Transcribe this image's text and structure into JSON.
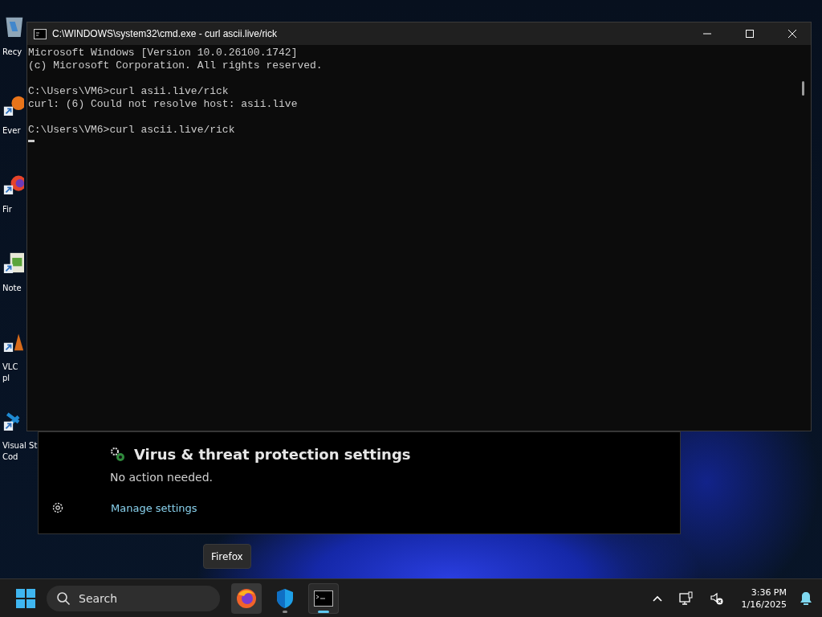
{
  "desktop_icons": [
    {
      "kind": "bin",
      "lines": [
        "Recy"
      ],
      "shortcut": false
    },
    {
      "kind": "app",
      "lines": [
        "Ever"
      ],
      "shortcut": true
    },
    {
      "kind": "firefox",
      "lines": [
        "Fir"
      ],
      "shortcut": true
    },
    {
      "kind": "notepad",
      "lines": [
        "Note"
      ],
      "shortcut": true
    },
    {
      "kind": "vlc",
      "lines": [
        "VLC",
        "pl"
      ],
      "shortcut": true
    },
    {
      "kind": "vscode",
      "lines": [
        "Visual St",
        "Cod"
      ],
      "shortcut": true
    }
  ],
  "console_window": {
    "title": "C:\\WINDOWS\\system32\\cmd.exe - curl  ascii.live/rick",
    "blocks": [
      [
        "Microsoft Windows [Version 10.0.26100.1742]",
        "(c) Microsoft Corporation. All rights reserved."
      ],
      [
        "C:\\Users\\VM6>curl asii.live/rick",
        "curl: (6) Could not resolve host: asii.live"
      ],
      [
        "C:\\Users\\VM6>curl ascii.live/rick"
      ]
    ],
    "cursor": true
  },
  "security_panel": {
    "heading": "Virus & threat protection settings",
    "status": "No action needed.",
    "link": "Manage settings"
  },
  "tooltip": "Firefox",
  "taskbar": {
    "search": {
      "placeholder": "Search"
    },
    "apps": [
      {
        "kind": "firefox",
        "running": false,
        "hovered": true,
        "selected": false
      },
      {
        "kind": "shield",
        "running": true,
        "hovered": false,
        "selected": false
      },
      {
        "kind": "terminal",
        "running": true,
        "hovered": false,
        "selected": true
      }
    ],
    "time": "3:36 PM",
    "date": "1/16/2025"
  }
}
